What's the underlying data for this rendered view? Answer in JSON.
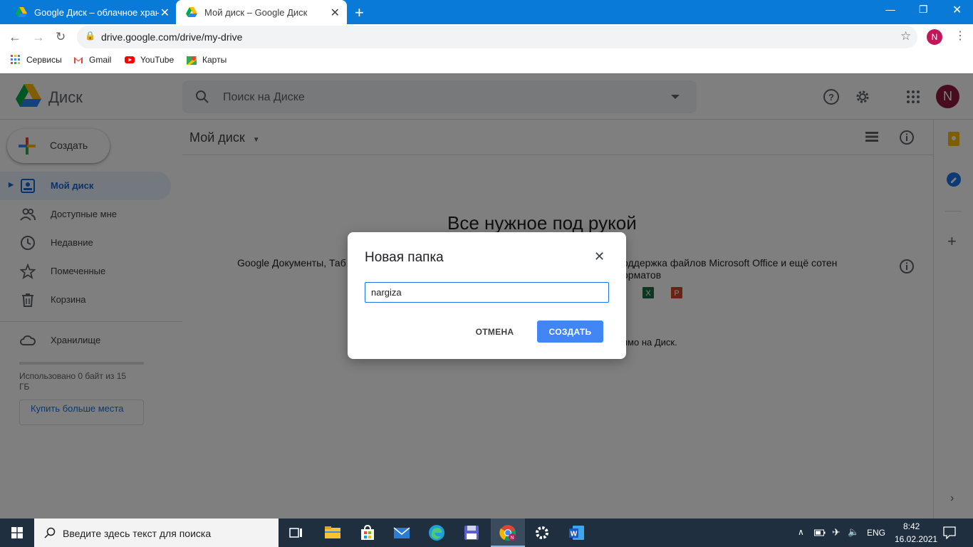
{
  "browser": {
    "tabs": [
      {
        "title": "Google Диск – облачное хранил",
        "active": false
      },
      {
        "title": "Мой диск – Google Диск",
        "active": true
      }
    ],
    "url": "drive.google.com/drive/my-drive",
    "profile_initial": "N",
    "bookmarks": [
      {
        "label": "Сервисы",
        "icon": "apps-grid-icon"
      },
      {
        "label": "Gmail",
        "icon": "gmail-icon"
      },
      {
        "label": "YouTube",
        "icon": "youtube-icon"
      },
      {
        "label": "Карты",
        "icon": "maps-icon"
      }
    ]
  },
  "drive": {
    "app_name": "Диск",
    "search_placeholder": "Поиск на Диске",
    "avatar_initial": "N",
    "create_label": "Создать",
    "nav": [
      {
        "label": "Мой диск",
        "icon": "my-drive-icon",
        "active": true
      },
      {
        "label": "Доступные мне",
        "icon": "shared-icon",
        "active": false
      },
      {
        "label": "Недавние",
        "icon": "recent-clock-icon",
        "active": false
      },
      {
        "label": "Помеченные",
        "icon": "star-icon",
        "active": false
      },
      {
        "label": "Корзина",
        "icon": "trash-icon",
        "active": false
      }
    ],
    "storage_label": "Хранилище",
    "storage_used": "Использовано 0 байт из 15 ГБ",
    "storage_fraction": 0,
    "buy_more": "Купить больше места",
    "page_title": "Мой диск",
    "empty": {
      "headline": "Все нужное под рукой",
      "left_text": "Google Документы, Таб",
      "right_text": "оддержка файлов Microsoft Office и ещё сотен",
      "right_text_2": "орматов",
      "bottom_text": "ямо на Диск."
    }
  },
  "dialog": {
    "title": "Новая папка",
    "input_value": "nargiza",
    "cancel_label": "ОТМЕНА",
    "create_label": "СОЗДАТЬ"
  },
  "taskbar": {
    "search_placeholder": "Введите здесь текст для поиска",
    "language": "ENG",
    "time": "8:42",
    "date": "16.02.2021"
  }
}
